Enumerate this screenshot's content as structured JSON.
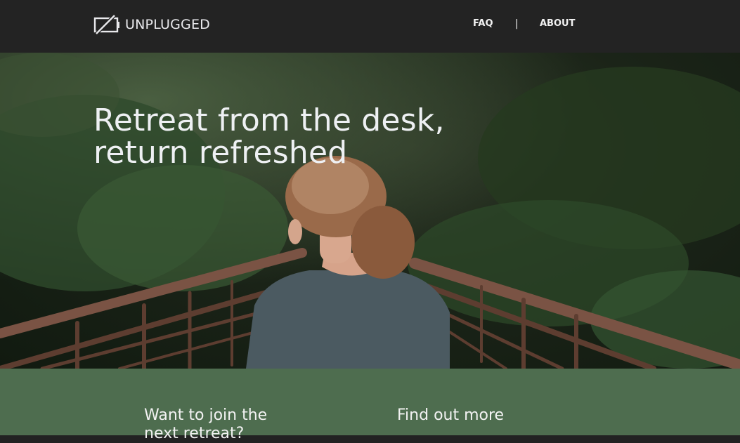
{
  "header": {
    "logo_text": "UNPLUGGED",
    "nav": [
      {
        "label": "FAQ"
      },
      {
        "label": "ABOUT"
      }
    ],
    "separator": "|"
  },
  "hero": {
    "title_line1": "Retreat from the desk,",
    "title_line2": "return refreshed"
  },
  "cta": {
    "join_line1": "Want to join the",
    "join_line2": "next retreat?",
    "more_heading": "Find out more"
  },
  "colors": {
    "header_bg": "#232323",
    "green_bg": "#4e6d4f"
  }
}
